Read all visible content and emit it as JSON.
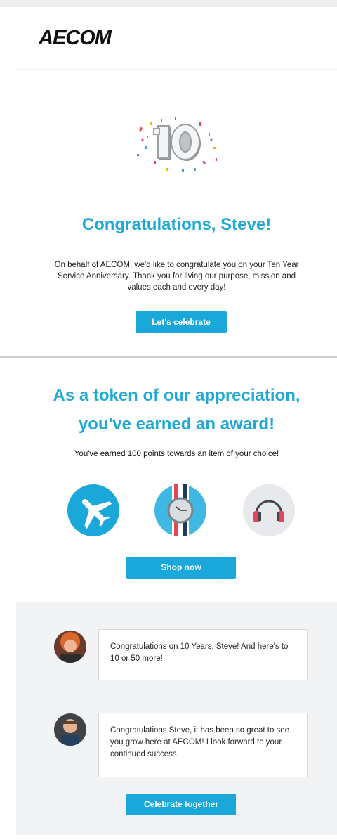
{
  "header": {
    "logo_text": "AECOM"
  },
  "hero": {
    "badge_number": "10",
    "title": "Congratulations, Steve!",
    "message": "On behalf of AECOM, we'd like to congratulate you on your Ten Year Service Anniversary. Thank you for living our purpose, mission and values each and every day!",
    "button_label": "Let's celebrate"
  },
  "award": {
    "title_line1": "As a token of our appreciation,",
    "title_line2": "you've earned an award!",
    "points_text": "You've earned 100 points towards an item of your choice!",
    "icons": [
      "airplane-icon",
      "watch-icon",
      "headphones-icon"
    ],
    "button_label": "Shop now"
  },
  "comments": {
    "items": [
      {
        "text": "Congratulations on 10 Years, Steve! And here's to 10 or 50 more!"
      },
      {
        "text": "Congratulations Steve, it has been so great to see you grow here at AECOM! I look forward to your continued success."
      }
    ],
    "button_label": "Celebrate together"
  },
  "colors": {
    "accent": "#1aa7da",
    "heading": "#20a9d6",
    "panel": "#f2f3f5"
  }
}
